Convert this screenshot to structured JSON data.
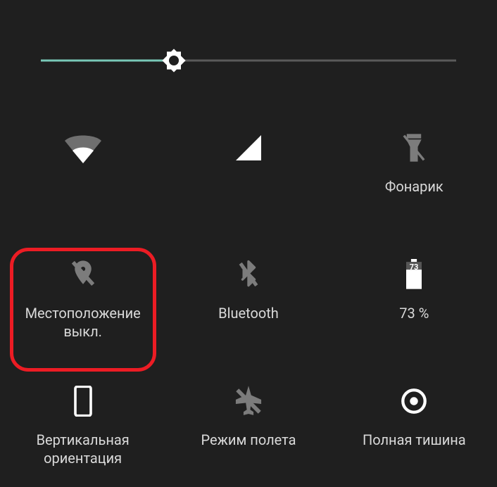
{
  "brightness": {
    "percent": 32
  },
  "tiles": {
    "wifi": {
      "label": ""
    },
    "signal": {
      "label": ""
    },
    "torch": {
      "label": "Фонарик"
    },
    "location": {
      "label": "Местоположение\nвыкл."
    },
    "bluetooth": {
      "label": "Bluetooth"
    },
    "battery": {
      "label": "73 %",
      "value": "73"
    },
    "rotation": {
      "label": "Вертикальная\nориентация"
    },
    "airplane": {
      "label": "Режим полета"
    },
    "dnd": {
      "label": "Полная тишина"
    }
  },
  "highlight": {
    "tile": "location"
  }
}
